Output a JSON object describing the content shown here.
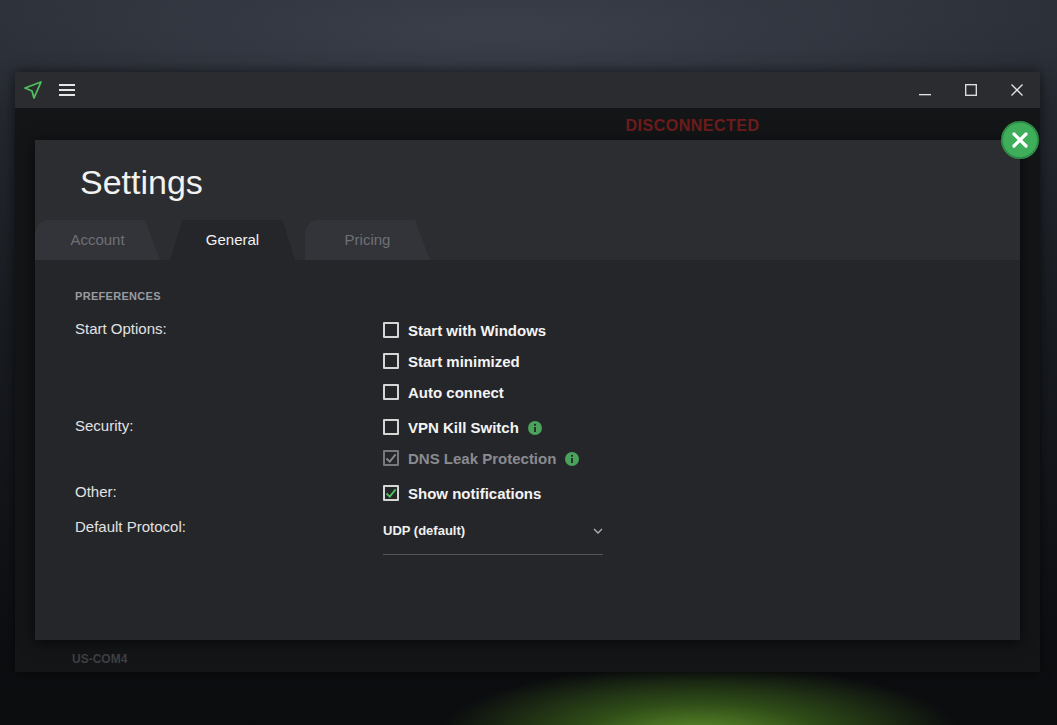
{
  "background_app": {
    "status": "DISCONNECTED",
    "server": "US-COM4"
  },
  "settings": {
    "title": "Settings",
    "tabs": [
      {
        "label": "Account",
        "selected": false
      },
      {
        "label": "General",
        "selected": true
      },
      {
        "label": "Pricing",
        "selected": false
      }
    ],
    "section": "PREFERENCES",
    "groups": [
      {
        "label": "Start Options:",
        "options": [
          {
            "kind": "checkbox",
            "label": "Start with Windows",
            "checked": false,
            "disabled": false,
            "info": false
          },
          {
            "kind": "checkbox",
            "label": "Start minimized",
            "checked": false,
            "disabled": false,
            "info": false
          },
          {
            "kind": "checkbox",
            "label": "Auto connect",
            "checked": false,
            "disabled": false,
            "info": false
          }
        ]
      },
      {
        "label": "Security:",
        "options": [
          {
            "kind": "checkbox",
            "label": "VPN Kill Switch",
            "checked": false,
            "disabled": false,
            "info": true
          },
          {
            "kind": "checkbox",
            "label": "DNS Leak Protection",
            "checked": true,
            "disabled": true,
            "info": true
          }
        ]
      },
      {
        "label": "Other:",
        "options": [
          {
            "kind": "checkbox",
            "label": "Show notifications",
            "checked": true,
            "disabled": false,
            "info": false
          }
        ]
      },
      {
        "label": "Default Protocol:",
        "options": [
          {
            "kind": "dropdown",
            "value": "UDP (default)"
          }
        ]
      }
    ]
  }
}
